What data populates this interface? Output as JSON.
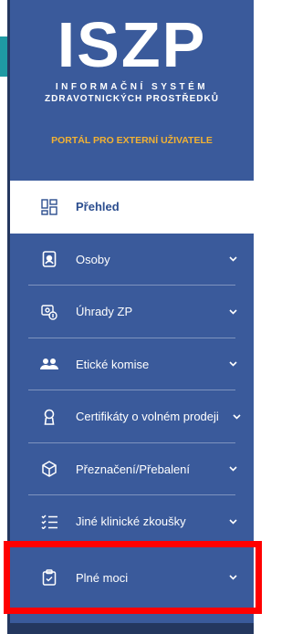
{
  "brand": {
    "logo": "ISZP",
    "line1": "INFORMAČNÍ SYSTÉM",
    "line2": "ZDRAVOTNICKÝCH PROSTŘEDKŮ",
    "portal": "PORTÁL PRO EXTERNÍ UŽIVATELE"
  },
  "menu": {
    "items": [
      {
        "label": "Přehled",
        "icon": "dashboard-icon",
        "active": true
      },
      {
        "label": "Osoby",
        "icon": "person-card-icon"
      },
      {
        "label": "Úhrady ZP",
        "icon": "payment-icon"
      },
      {
        "label": "Etické komise",
        "icon": "group-icon"
      },
      {
        "label": "Certifikáty o volném prodeji",
        "icon": "certificate-icon"
      },
      {
        "label": "Přeznačení/Přebalení",
        "icon": "box-icon"
      },
      {
        "label": "Jiné klinické zkoušky",
        "icon": "checklist-icon"
      },
      {
        "label": "Plné moci",
        "icon": "clipboard-icon"
      }
    ]
  },
  "colors": {
    "sidebar": "#3a5a9b",
    "accent": "#f2b233",
    "highlight": "#ff0000",
    "active_text": "#2c4e8f"
  }
}
